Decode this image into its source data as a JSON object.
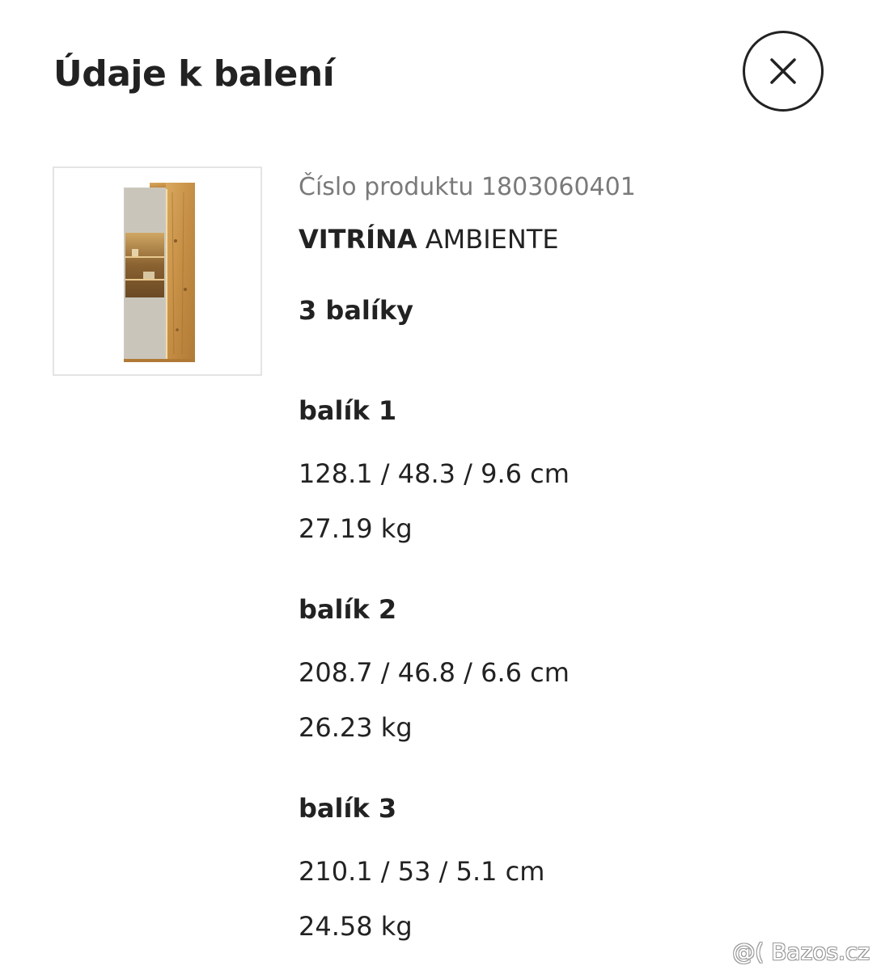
{
  "header": {
    "title": "Údaje k balení",
    "close_icon": "close-icon"
  },
  "product": {
    "number_text": "Číslo produktu 1803060401",
    "name_bold": "VITRÍNA",
    "name_rest": " AMBIENTE",
    "package_count": "3 balíky",
    "image_icon": "vitrine-cabinet-image"
  },
  "packages": [
    {
      "label": "balík 1",
      "dimensions": "128.1 / 48.3 / 9.6 cm",
      "weight": "27.19 kg"
    },
    {
      "label": "balík 2",
      "dimensions": "208.7 / 46.8 / 6.6 cm",
      "weight": "26.23 kg"
    },
    {
      "label": "balík 3",
      "dimensions": "210.1 / 53 / 5.1 cm",
      "weight": "24.58 kg"
    }
  ],
  "watermark": "@( Bazos.cz",
  "colors": {
    "text": "#222222",
    "muted": "#7a7a7a",
    "border": "#e4e4e4",
    "oak": "#c9974f",
    "beige": "#cbc7bd"
  }
}
